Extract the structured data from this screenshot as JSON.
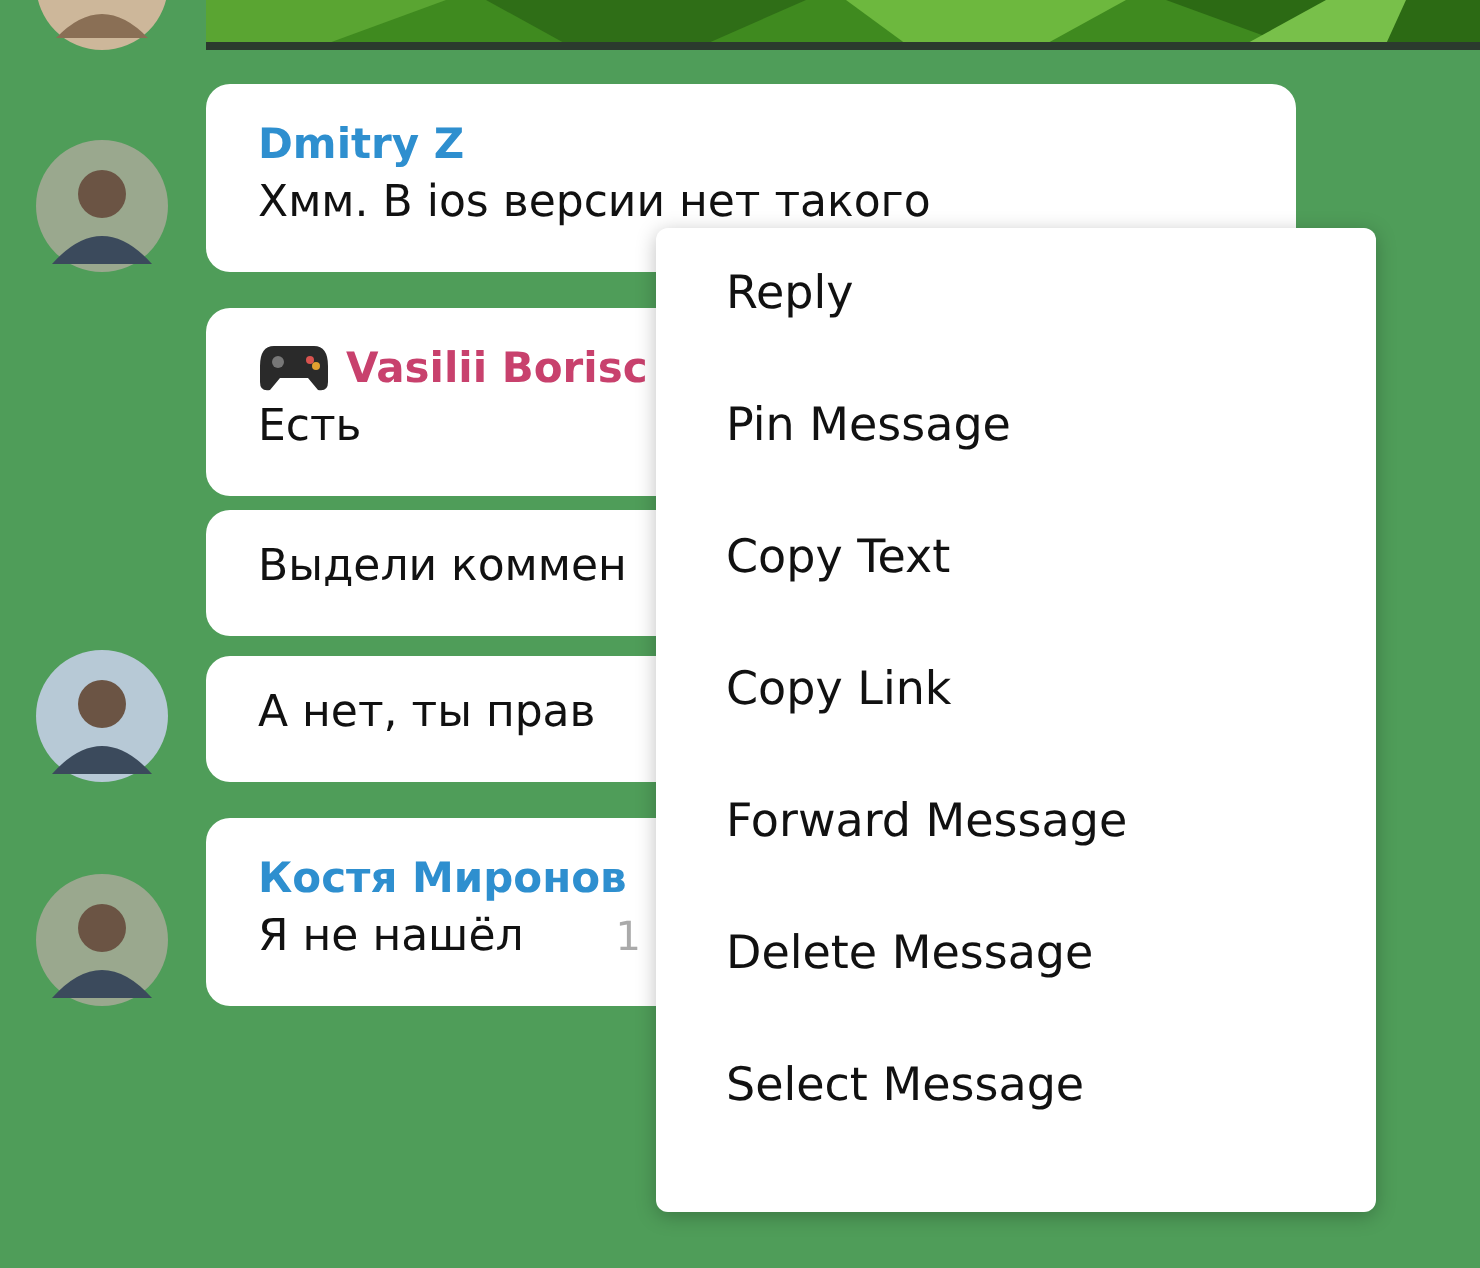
{
  "top_avatar": true,
  "messages": [
    {
      "sender": "Dmitry Z",
      "color": "#2e8fcf",
      "text": "Хмм. В ios версии нет такого",
      "avatar": true
    },
    {
      "sender": "Vasilii Borisc",
      "color": "#c8416d",
      "has_icon": true,
      "text": "Есть"
    },
    {
      "text": "Выдели коммен"
    },
    {
      "text": "А нет, ты прав",
      "avatar": true
    },
    {
      "sender": "Костя Миронов",
      "color": "#2e8fcf",
      "text": "Я не нашёл",
      "time": "1",
      "avatar": true
    }
  ],
  "context_menu": [
    "Reply",
    "Pin Message",
    "Copy Text",
    "Copy Link",
    "Forward Message",
    "Delete Message",
    "Select Message"
  ]
}
